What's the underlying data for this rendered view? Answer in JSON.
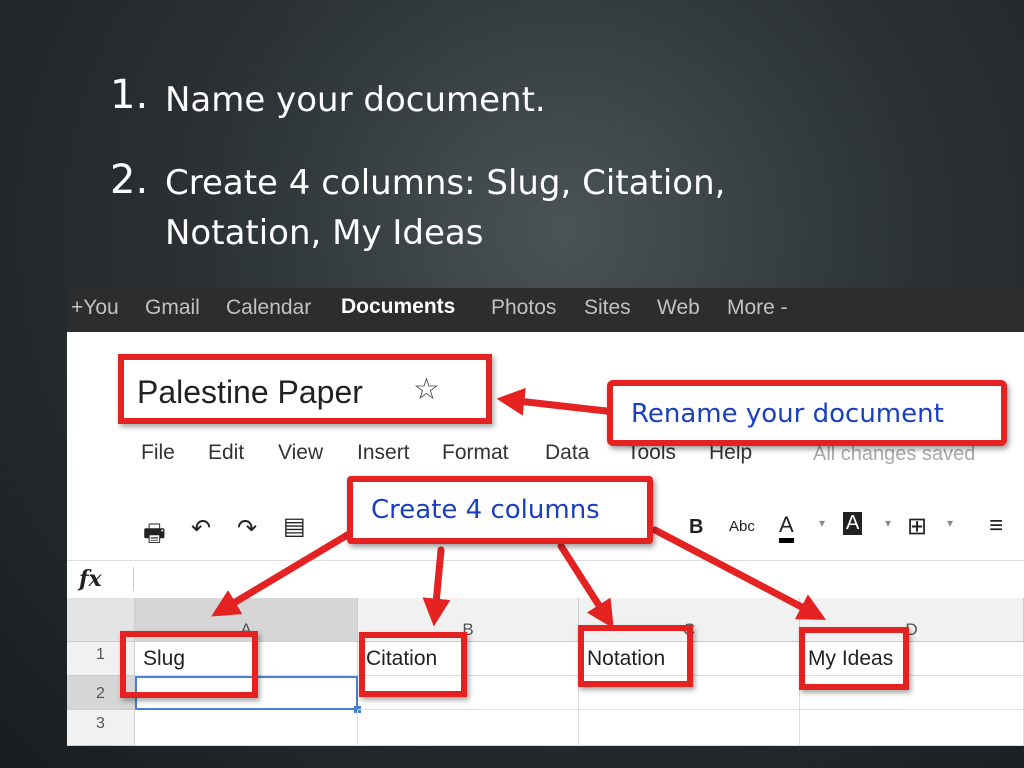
{
  "slide": {
    "steps": [
      {
        "number": "1.",
        "lines": [
          "Name your document."
        ]
      },
      {
        "number": "2.",
        "lines": [
          "Create 4 columns:  Slug, Citation,",
          "Notation, My Ideas"
        ]
      }
    ]
  },
  "google_bar": {
    "items": [
      "+You",
      "Gmail",
      "Calendar",
      "Documents",
      "Photos",
      "Sites",
      "Web",
      "More -"
    ],
    "active": "Documents"
  },
  "document": {
    "title": "Palestine Paper",
    "menu": [
      "File",
      "Edit",
      "View",
      "Insert",
      "Format",
      "Data",
      "Tools",
      "Help"
    ],
    "save_status": "All changes saved"
  },
  "formula_bar": {
    "label": "fx",
    "value": ""
  },
  "spreadsheet": {
    "columns": [
      "A",
      "B",
      "C",
      "D"
    ],
    "rows": [
      "1",
      "2",
      "3"
    ],
    "row1": [
      "Slug",
      "Citation",
      "Notation",
      "My Ideas"
    ]
  },
  "annotations": {
    "rename": "Rename your document",
    "create_columns": "Create 4 columns"
  },
  "colors": {
    "annotation_red": "#e52222",
    "annotation_text": "#1a3fc0",
    "google_bar_bg": "#2d2d2d"
  }
}
